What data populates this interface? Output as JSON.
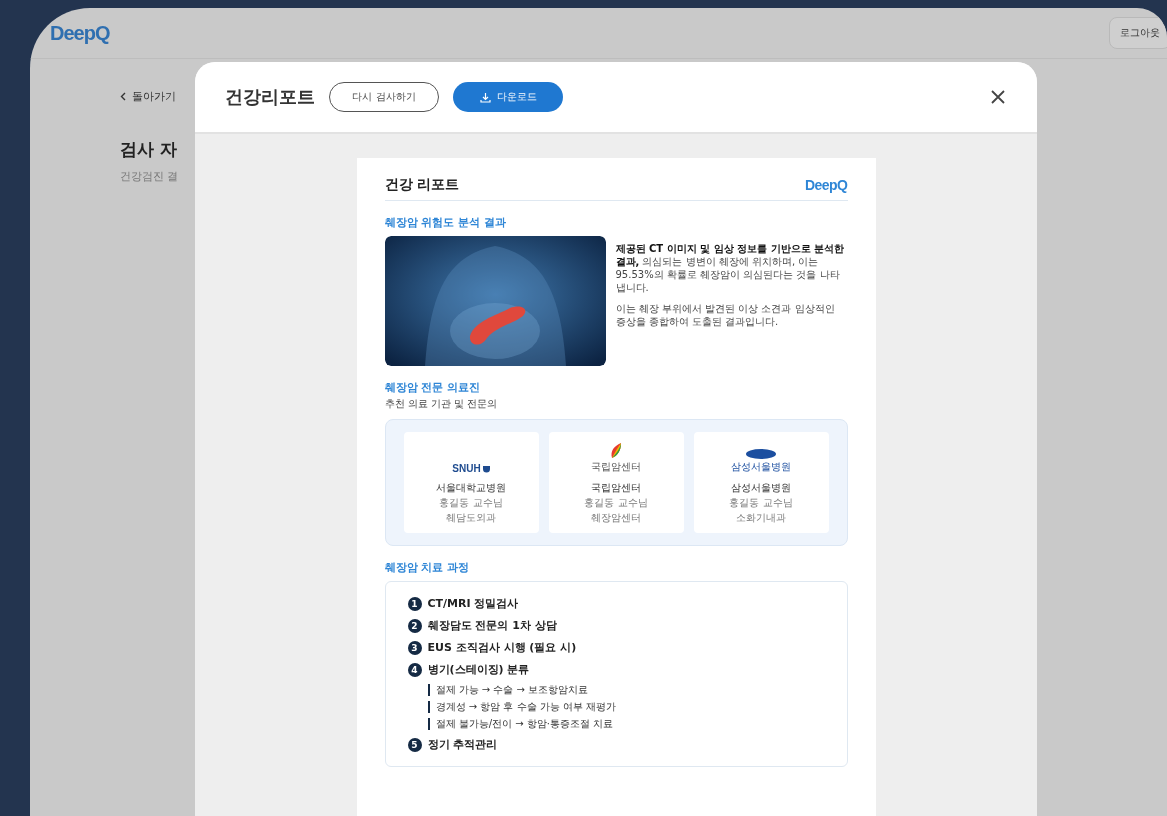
{
  "app": {
    "logo": "DeepQ",
    "logout_button": "로그아웃",
    "back_link": "돌아가기",
    "page_title": "검사 자",
    "page_subtitle": "건강검진 결"
  },
  "modal": {
    "title": "건강리포트",
    "buttons": [
      {
        "label": "다시 검사하기",
        "kind": "outline"
      },
      {
        "label": "다운로드",
        "kind": "primary"
      }
    ]
  },
  "report": {
    "title": "건강 리포트",
    "logo": "DeepQ",
    "analysis": {
      "heading": "췌장암 위험도 분석 결과",
      "paragraphs": [
        "**제공된 CT 이미지 및 임상 정보를 기반으로 분석한 결과,** 의심되는 병변이 췌장에 위치하며, 이는 95.53%의 확률로 췌장암이 의심된다는 것을 나타냅니다.",
        "이는 췌장 부위에서 발견된 이상 소견과 임상적인 증상을 종합하여 도출된 결과입니다."
      ]
    },
    "specialists": {
      "heading": "췌장암 전문 의료진",
      "subheading": "추천 의료 기관 및 전문의",
      "hospitals": [
        {
          "kind": "snuh",
          "logo_text": "SNUH",
          "name": "서울대학교병원",
          "doctor": "홍길동 교수님",
          "department": "췌담도외과"
        },
        {
          "kind": "ncc",
          "logo_text": "국립암센터",
          "name": "국립암센터",
          "doctor": "홍길동 교수님",
          "department": "췌장암센터"
        },
        {
          "kind": "samsung",
          "logo_text": "삼성서울병원",
          "name": "삼성서울병원",
          "doctor": "홍길동 교수님",
          "department": "소화기내과"
        }
      ]
    },
    "treatment": {
      "heading": "췌장암 치료 과정",
      "steps": [
        {
          "number": "1",
          "label": "CT/MRI 정밀검사"
        },
        {
          "number": "2",
          "label": "췌장담도 전문의 1차 상담"
        },
        {
          "number": "3",
          "label": "EUS 조직검사 시행 (필요 시)"
        },
        {
          "number": "4",
          "label": "병기(스테이징) 분류",
          "children": [
            {
              "label": "절제 가능 → 수술 → 보조항암치료"
            },
            {
              "label": "경계성 → 항암 후 수술 가능 여부 재평가"
            },
            {
              "label": "절제 불가능/전이 → 항암·통증조절 치료"
            }
          ]
        },
        {
          "number": "5",
          "label": "정기 추적관리"
        }
      ]
    }
  }
}
